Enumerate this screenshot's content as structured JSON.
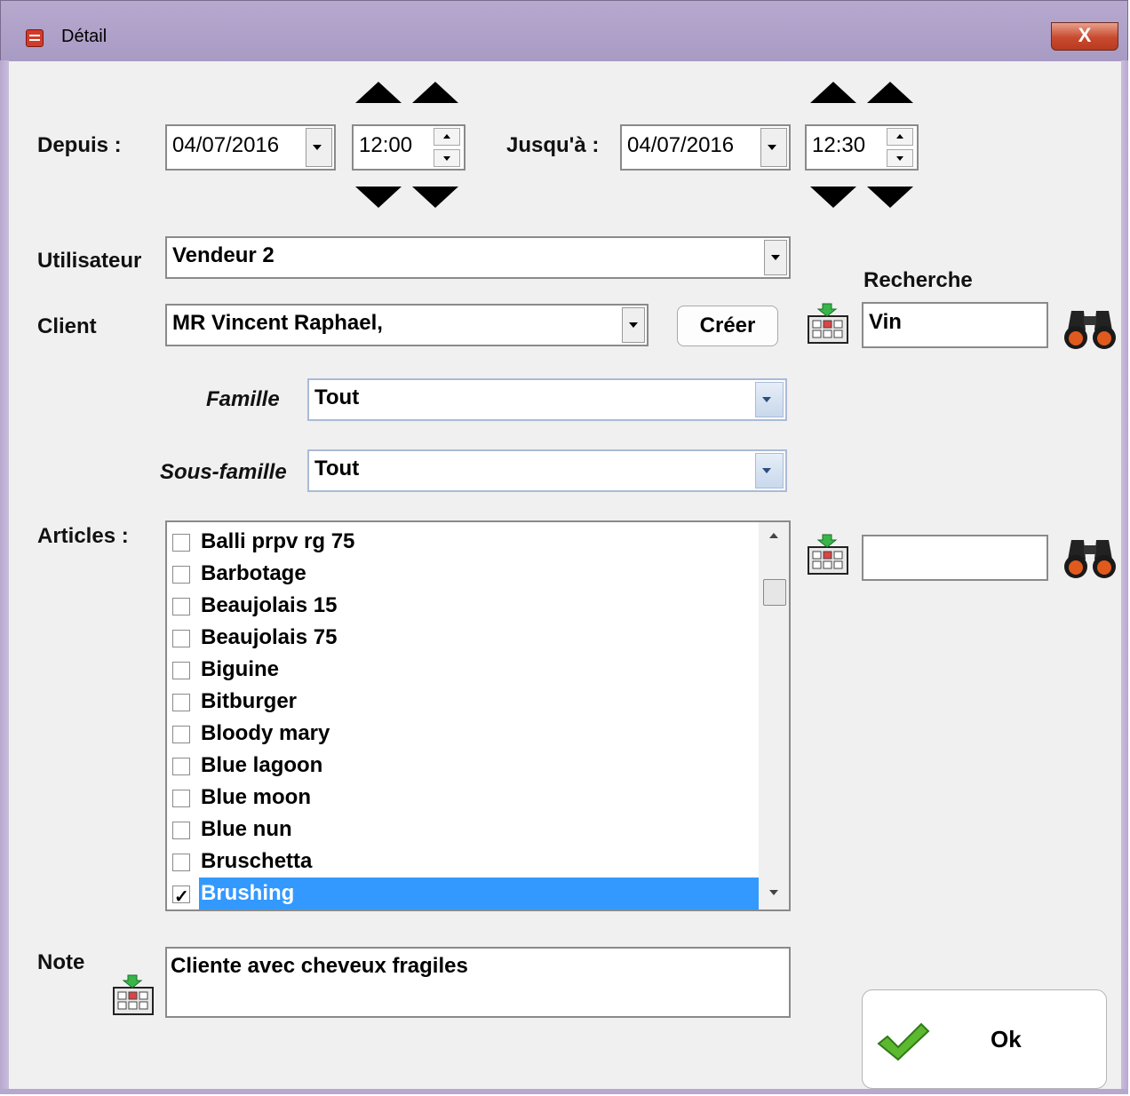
{
  "window": {
    "title": "Détail",
    "close_label": "X"
  },
  "period": {
    "from_label": "Depuis :",
    "from_date": "04/07/2016",
    "from_time": "12:00",
    "to_label": "Jusqu'à :",
    "to_date": "04/07/2016",
    "to_time": "12:30"
  },
  "user": {
    "label": "Utilisateur",
    "value": "Vendeur 2"
  },
  "client": {
    "label": "Client",
    "value": "MR Vincent Raphael,",
    "create_label": "Créer"
  },
  "search": {
    "label": "Recherche",
    "client_query": "Vin",
    "article_query": ""
  },
  "family": {
    "label": "Famille",
    "value": "Tout"
  },
  "subfamily": {
    "label": "Sous-famille",
    "value": "Tout"
  },
  "articles": {
    "label": "Articles :",
    "items": [
      {
        "name": "Balli prpv rg 75",
        "checked": false
      },
      {
        "name": "Barbotage",
        "checked": false
      },
      {
        "name": "Beaujolais 15",
        "checked": false
      },
      {
        "name": "Beaujolais 75",
        "checked": false
      },
      {
        "name": "Biguine",
        "checked": false
      },
      {
        "name": "Bitburger",
        "checked": false
      },
      {
        "name": "Bloody mary",
        "checked": false
      },
      {
        "name": "Blue lagoon",
        "checked": false
      },
      {
        "name": "Blue moon",
        "checked": false
      },
      {
        "name": "Blue nun",
        "checked": false
      },
      {
        "name": "Bruschetta",
        "checked": false
      },
      {
        "name": "Brushing",
        "checked": true,
        "selected": true
      }
    ]
  },
  "note": {
    "label": "Note",
    "value": "Cliente avec cheveux fragiles"
  },
  "ok": {
    "label": "Ok"
  },
  "colors": {
    "title_bar": "#b7a8cf",
    "selection": "#3399ff",
    "close": "#c74a2e",
    "check": "#5cb82e"
  },
  "icons": {
    "keyboard": "keyboard-icon",
    "binoculars": "binoculars-icon",
    "check": "checkmark-icon",
    "app": "app-icon"
  }
}
